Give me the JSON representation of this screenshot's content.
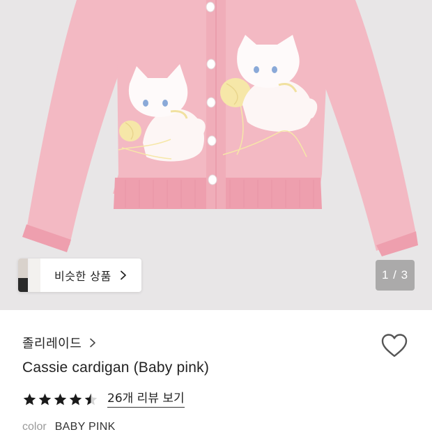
{
  "gallery": {
    "similar_products_label": "비슷한 상품",
    "page_indicator": "1 / 3",
    "colors": {
      "background": "#e8e6e7",
      "garment": "#f3b9c3",
      "knit_trim": "#ee9fae",
      "kitten": "#fdf6f5",
      "yarn": "#f4e6a8",
      "buttons": "#ffffff"
    }
  },
  "product": {
    "brand": "졸리레이드",
    "name": "Cassie cardigan (Baby pink)",
    "rating": 4.5,
    "review_link": "26개 리뷰 보기",
    "color_label": "color",
    "color_value": "BABY PINK"
  },
  "icons": {
    "wishlist": "heart-outline-icon",
    "brand_chevron": "chevron-right-icon",
    "similar_chevron": "chevron-right-icon",
    "star": "star-icon"
  }
}
